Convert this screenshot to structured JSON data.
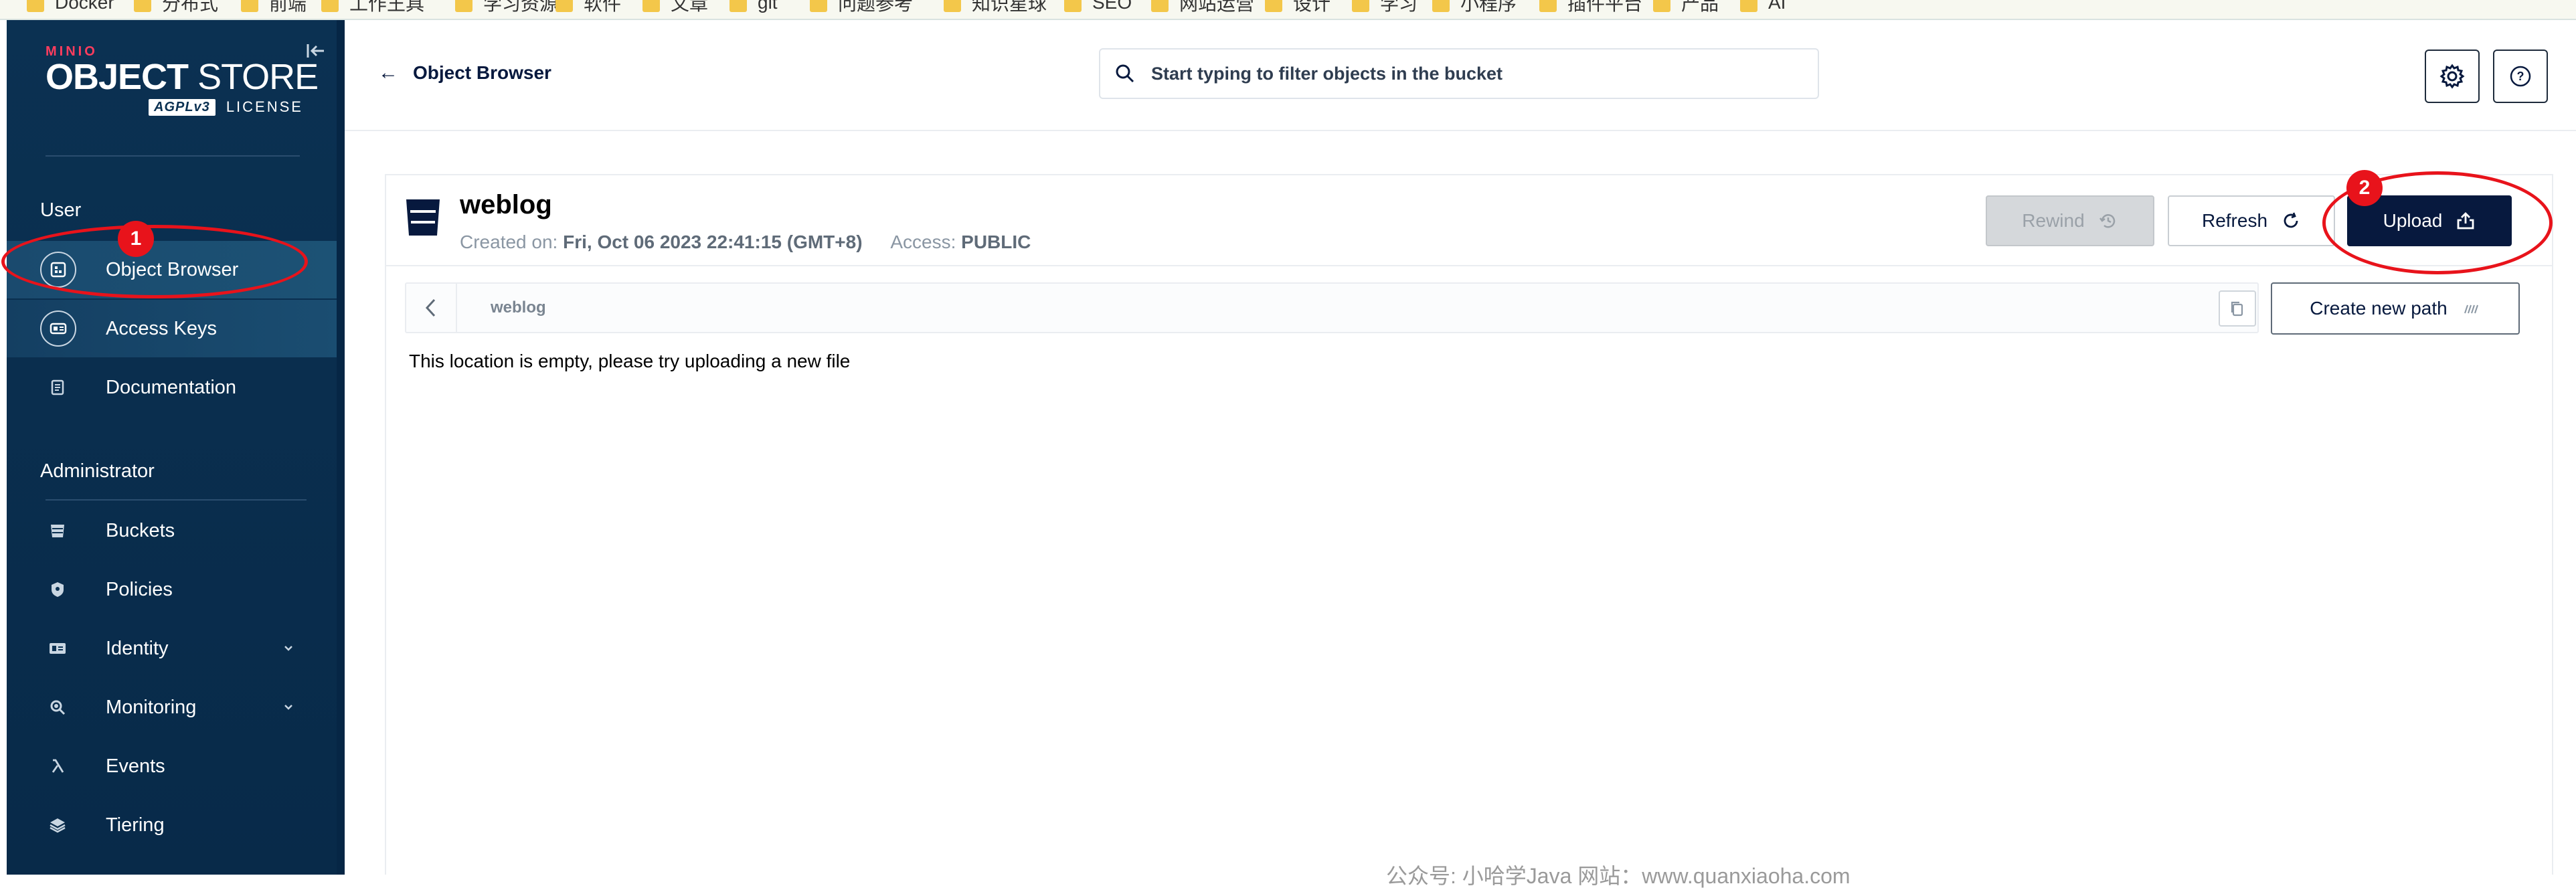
{
  "bookmarks": [
    {
      "label": "Docker"
    },
    {
      "label": "分布式"
    },
    {
      "label": "前端"
    },
    {
      "label": "工作王具"
    },
    {
      "label": "学习资源"
    },
    {
      "label": "软件"
    },
    {
      "label": "文章"
    },
    {
      "label": "git"
    },
    {
      "label": "问题参考"
    },
    {
      "label": "知识星球"
    },
    {
      "label": "SEO"
    },
    {
      "label": "网站运营"
    },
    {
      "label": "设计"
    },
    {
      "label": "学习"
    },
    {
      "label": "小程序"
    },
    {
      "label": "插件平台"
    },
    {
      "label": "产品"
    },
    {
      "label": "AI"
    }
  ],
  "logo": {
    "brand": "MINIO",
    "title_bold": "OBJECT",
    "title_light": "STORE",
    "agpl": "AGPLv3",
    "license": "LICENSE"
  },
  "sidebar": {
    "user_section": "User",
    "user_items": [
      {
        "label": "Object Browser",
        "icon": "object-browser-icon"
      },
      {
        "label": "Access Keys",
        "icon": "access-keys-icon"
      },
      {
        "label": "Documentation",
        "icon": "documentation-icon"
      }
    ],
    "admin_section": "Administrator",
    "admin_items": [
      {
        "label": "Buckets",
        "icon": "buckets-icon"
      },
      {
        "label": "Policies",
        "icon": "policies-icon"
      },
      {
        "label": "Identity",
        "icon": "identity-icon",
        "expandable": true
      },
      {
        "label": "Monitoring",
        "icon": "monitoring-icon",
        "expandable": true
      },
      {
        "label": "Events",
        "icon": "lambda-icon"
      },
      {
        "label": "Tiering",
        "icon": "tiering-icon"
      }
    ]
  },
  "header": {
    "back_label": "Object Browser",
    "search_placeholder": "Start typing to filter objects in the bucket"
  },
  "bucket": {
    "name": "weblog",
    "created_label": "Created on:",
    "created_value": "Fri, Oct 06 2023 22:41:15 (GMT+8)",
    "access_label": "Access:",
    "access_value": "PUBLIC"
  },
  "actions": {
    "rewind": "Rewind",
    "refresh": "Refresh",
    "upload": "Upload",
    "create_path": "Create new path"
  },
  "path": {
    "current": "weblog"
  },
  "empty_message": "This location is empty, please try uploading a new file",
  "annotations": {
    "badge1": "1",
    "badge2": "2"
  },
  "watermark": "公众号: 小哈学Java  网站：www.quanxiaoha.com",
  "colors": {
    "sidebar": "#0b3152",
    "accent_navy": "#07193E",
    "annotation_red": "#e8131b",
    "brand_red": "#ff3d5e"
  }
}
